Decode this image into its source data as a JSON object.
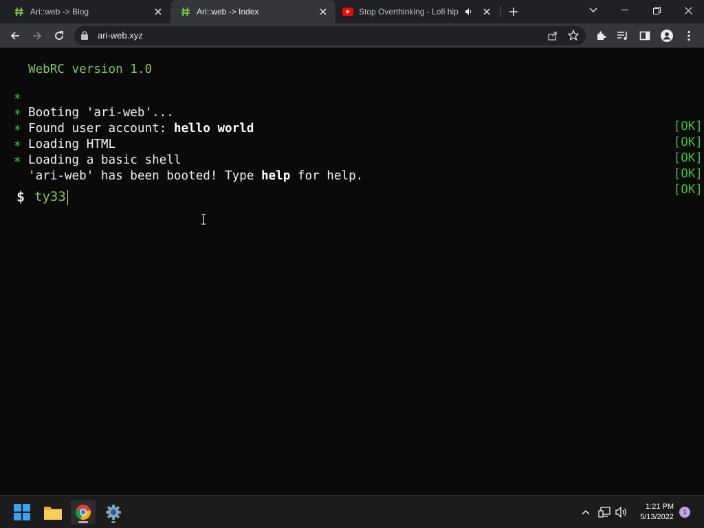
{
  "browser": {
    "tabs": [
      {
        "title": "Ari::web -> Blog",
        "icon": "hash-favicon-icon",
        "active": false
      },
      {
        "title": "Ari::web -> Index",
        "icon": "hash-favicon-icon",
        "active": true
      },
      {
        "title": "Stop Overthinking - Lofi hip h",
        "icon": "youtube-favicon-icon",
        "active": false,
        "audio": true
      }
    ],
    "url": "ari-web.xyz"
  },
  "terminal": {
    "version_line": "WebRC version 1.0",
    "boot_lines": [
      {
        "bullet": "*",
        "parts": [
          {
            "text": "Booting 'ari-web'...",
            "bold": false
          }
        ],
        "status": "[OK]"
      },
      {
        "bullet": "*",
        "parts": [
          {
            "text": "Found user account: ",
            "bold": false
          },
          {
            "text": "hello world",
            "bold": true
          }
        ],
        "status": "[OK]"
      },
      {
        "bullet": "*",
        "parts": [
          {
            "text": "Loading HTML",
            "bold": false
          }
        ],
        "status": "[OK]"
      },
      {
        "bullet": "*",
        "parts": [
          {
            "text": "Loading a basic shell",
            "bold": false
          }
        ],
        "status": "[OK]"
      },
      {
        "bullet": "*",
        "parts": [
          {
            "text": "'ari-web' has been booted! Type ",
            "bold": false
          },
          {
            "text": "help",
            "bold": true
          },
          {
            "text": " for help.",
            "bold": false
          }
        ],
        "status": "[OK]"
      }
    ],
    "prompt": "$",
    "input": "ty33"
  },
  "taskbar": {
    "time": "1:21 PM",
    "date": "5/13/2022",
    "notifications": "1"
  },
  "colors": {
    "terminal_bg": "#0a0a0a",
    "terminal_green": "#3fbf3f",
    "terminal_light_green": "#82c45a",
    "tab_bar": "#202124",
    "toolbar": "#35363a"
  }
}
